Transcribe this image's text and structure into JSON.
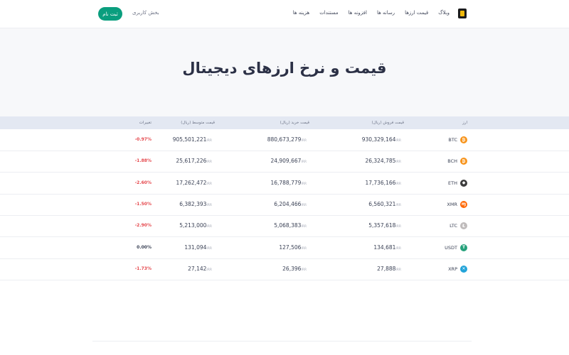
{
  "header": {
    "nav": [
      "هزینه ها",
      "مستندات",
      "افزونه ها",
      "رسانه ها",
      "قیمت ارزها",
      "وبلاگ"
    ],
    "user_area": "بخش کاربری",
    "signup": "ثبت نام"
  },
  "hero": {
    "title": "قیمت و نرخ ارزهای دیجیتال"
  },
  "table": {
    "columns": {
      "coin": "ارز",
      "sell": "قیمت فروش (ریال)",
      "buy": "قیمت خرید (ریال)",
      "mid": "قیمت متوسط (ریال)",
      "change": "تغییرات"
    },
    "unit": "IRR",
    "rows": [
      {
        "symbol": "BTC",
        "icon": "bitcoin-icon",
        "color": "#f7931a",
        "sell": "930,329,164",
        "buy": "880,673,279",
        "mid": "905,501,221",
        "change": "-0.97%",
        "negative": true
      },
      {
        "symbol": "BCH",
        "icon": "bitcoin-cash-icon",
        "color": "#f7931a",
        "sell": "26,324,785",
        "buy": "24,909,667",
        "mid": "25,617,226",
        "change": "-1.88%",
        "negative": true
      },
      {
        "symbol": "ETH",
        "icon": "ethereum-icon",
        "color": "#3c3c3d",
        "sell": "17,736,166",
        "buy": "16,788,779",
        "mid": "17,262,472",
        "change": "-2.60%",
        "negative": true
      },
      {
        "symbol": "XMR",
        "icon": "monero-icon",
        "color": "#ff6600",
        "sell": "6,560,321",
        "buy": "6,204,466",
        "mid": "6,382,393",
        "change": "-1.50%",
        "negative": true
      },
      {
        "symbol": "LTC",
        "icon": "litecoin-icon",
        "color": "#bfbbbb",
        "sell": "5,357,618",
        "buy": "5,068,383",
        "mid": "5,213,000",
        "change": "-2.90%",
        "negative": true
      },
      {
        "symbol": "USDT",
        "icon": "tether-icon",
        "color": "#26a17b",
        "sell": "134,681",
        "buy": "127,506",
        "mid": "131,094",
        "change": "0.00%",
        "negative": false
      },
      {
        "symbol": "XRP",
        "icon": "ripple-icon",
        "color": "#23a4d9",
        "sell": "27,888",
        "buy": "26,396",
        "mid": "27,142",
        "change": "-1.73%",
        "negative": true
      }
    ]
  }
}
